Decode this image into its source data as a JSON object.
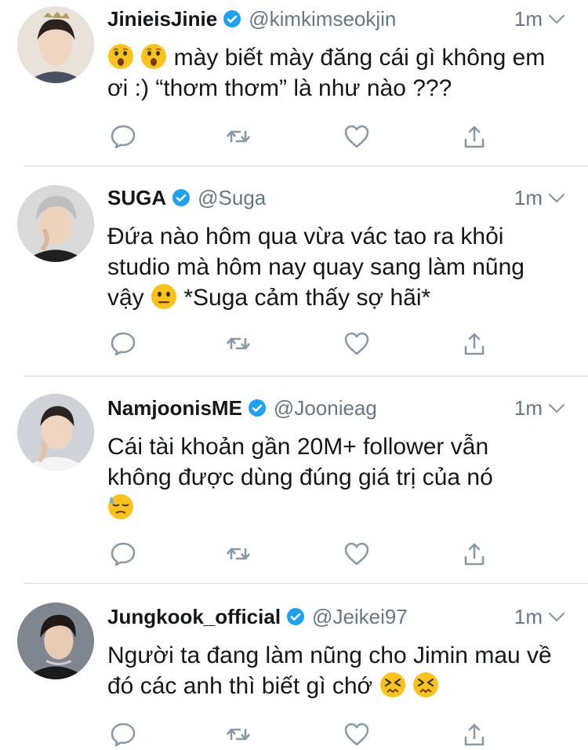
{
  "tweets": [
    {
      "name": "JinieisJinie",
      "handle": "@kimkimseokjin",
      "time": "1m",
      "text_prefix": "",
      "text_mid": " mày biết mày đăng cái gì không em ơi :) “thơm thơm” là như nào ???",
      "text_suffix": "",
      "emoji_lead": [
        "hushed-face",
        "hushed-face"
      ],
      "emoji_tail": []
    },
    {
      "name": "SUGA",
      "handle": "@Suga",
      "time": "1m",
      "text_prefix": "Đứa nào hôm qua vừa vác tao ra khỏi studio mà hôm nay quay sang làm nũng vậy ",
      "text_mid": " *Suga cảm thấy sợ hãi*",
      "text_suffix": "",
      "emoji_lead": [
        "neutral-face"
      ],
      "emoji_tail": []
    },
    {
      "name": "NamjoonisME",
      "handle": "@Joonieag",
      "time": "1m",
      "text_prefix": "Cái tài khoản gần 20M+ follower vẫn không được dùng đúng giá trị của nó",
      "text_mid": "",
      "text_suffix": "",
      "emoji_lead": [
        "downcast-sweat-face"
      ],
      "emoji_tail": []
    },
    {
      "name": "Jungkook_official",
      "handle": "@Jeikei97",
      "time": "1m",
      "text_prefix": "Người ta đang làm nũng cho Jimin mau về đó các anh thì biết gì chớ ",
      "text_mid": "",
      "text_suffix": "",
      "emoji_lead": [
        "confounded-face",
        "confounded-face"
      ],
      "emoji_tail": []
    }
  ],
  "icons": {
    "verified": "verified-badge-icon",
    "caret": "chevron-down-icon",
    "reply": "reply-icon",
    "retweet": "retweet-icon",
    "like": "heart-icon",
    "share": "share-icon"
  },
  "colors": {
    "text": "#14171a",
    "secondary": "#657786",
    "verified": "#1da1f2",
    "divider": "#d6dbe0"
  }
}
